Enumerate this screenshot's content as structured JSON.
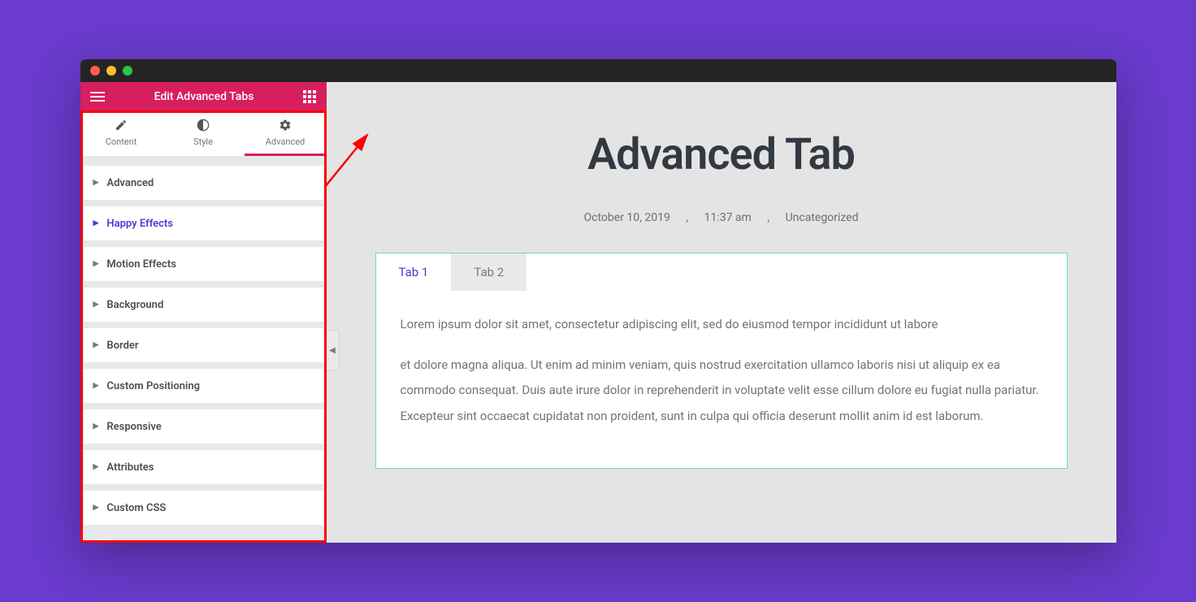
{
  "sidebar": {
    "title": "Edit Advanced Tabs",
    "tabs": [
      {
        "label": "Content"
      },
      {
        "label": "Style"
      },
      {
        "label": "Advanced"
      }
    ],
    "sections": [
      {
        "label": "Advanced"
      },
      {
        "label": "Happy Effects",
        "highlight": true
      },
      {
        "label": "Motion Effects"
      },
      {
        "label": "Background"
      },
      {
        "label": "Border"
      },
      {
        "label": "Custom Positioning"
      },
      {
        "label": "Responsive"
      },
      {
        "label": "Attributes"
      },
      {
        "label": "Custom CSS"
      }
    ]
  },
  "page": {
    "title": "Advanced Tab",
    "meta": {
      "date": "October 10, 2019",
      "time": "11:37 am",
      "category": "Uncategorized",
      "sep1": ",",
      "sep2": ","
    },
    "tabs": [
      {
        "label": "Tab 1"
      },
      {
        "label": "Tab 2"
      }
    ],
    "content_p1": "Lorem ipsum dolor sit amet, consectetur adipiscing elit, sed do eiusmod tempor incididunt ut labore",
    "content_p2": "et dolore magna aliqua. Ut enim ad minim veniam, quis nostrud exercitation ullamco laboris nisi ut aliquip ex ea commodo consequat. Duis aute irure dolor in reprehenderit in voluptate velit esse cillum dolore eu fugiat nulla pariatur. Excepteur sint occaecat cupidatat non proident, sunt in culpa qui officia deserunt mollit anim id est laborum."
  }
}
